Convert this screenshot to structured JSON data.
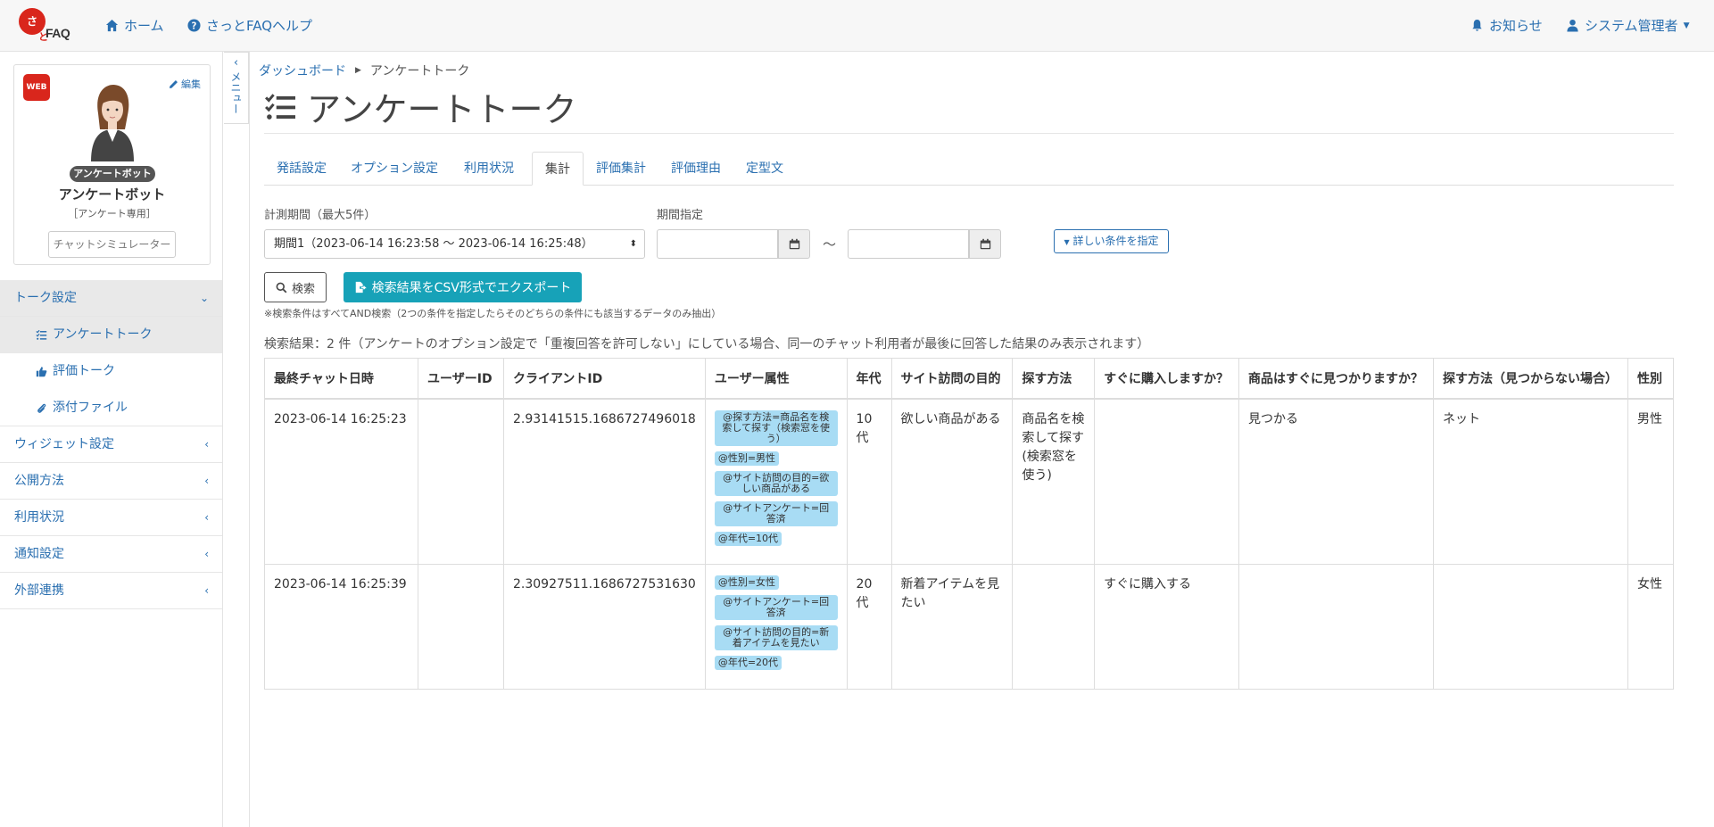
{
  "navbar": {
    "logo_text": "FAQ",
    "home": "ホーム",
    "help": "さっとFAQヘルプ",
    "notify": "お知らせ",
    "user": "システム管理者"
  },
  "bot": {
    "badge": "WEB",
    "edit": "編集",
    "tag": "アンケートボット",
    "name": "アンケートボット",
    "sub": "［アンケート専用］",
    "simulator": "チャットシミュレーター"
  },
  "menu": {
    "talk_settings": "トーク設定",
    "survey_talk": "アンケートトーク",
    "eval_talk": "評価トーク",
    "attachments": "添付ファイル",
    "widget": "ウィジェット設定",
    "publish": "公開方法",
    "usage": "利用状況",
    "notify": "通知設定",
    "external": "外部連携",
    "toggle_label": "メニュー"
  },
  "breadcrumb": {
    "dashboard": "ダッシュボード",
    "current": "アンケートトーク"
  },
  "page_title": "アンケートトーク",
  "tabs": [
    "発話設定",
    "オプション設定",
    "利用状況",
    "集計",
    "評価集計",
    "評価理由",
    "定型文"
  ],
  "filter": {
    "period_label": "計測期間（最大5件）",
    "period_value": "期間1（2023-06-14 16:23:58 〜 2023-06-14 16:25:48）",
    "range_label": "期間指定",
    "tilde": "〜",
    "detail": "詳しい条件を指定",
    "search": "検索",
    "export": "検索結果をCSV形式でエクスポート",
    "note": "※検索条件はすべてAND検索（2つの条件を指定したらそのどちらの条件にも該当するデータのみ抽出）"
  },
  "result_count": "検索結果：2 件（アンケートのオプション設定で「重複回答を許可しない」にしている場合、同一のチャット利用者が最後に回答した結果のみ表示されます）",
  "table": {
    "headers": [
      "最終チャット日時",
      "ユーザーID",
      "クライアントID",
      "ユーザー属性",
      "年代",
      "サイト訪問の目的",
      "探す方法",
      "すぐに購入しますか？",
      "商品はすぐに見つかりますか？",
      "探す方法（見つからない場合）",
      "性別"
    ],
    "rows": [
      {
        "datetime": "2023-06-14 16:25:23",
        "user_id": "",
        "client_id": "2.93141515.1686727496018",
        "tags": [
          "@探す方法=商品名を検索して探す（検索窓を使う）",
          "@性別=男性",
          "@サイト訪問の目的=欲しい商品がある",
          "@サイトアンケート=回答済",
          "@年代=10代"
        ],
        "age": "10代",
        "purpose": "欲しい商品がある",
        "method": "商品名を検索して探す(検索窓を使う)",
        "buy_now": "",
        "find": "見つかる",
        "method_nf": "ネット",
        "gender": "男性"
      },
      {
        "datetime": "2023-06-14 16:25:39",
        "user_id": "",
        "client_id": "2.30927511.1686727531630",
        "tags": [
          "@性別=女性",
          "@サイトアンケート=回答済",
          "@サイト訪問の目的=新着アイテムを見たい",
          "@年代=20代"
        ],
        "age": "20代",
        "purpose": "新着アイテムを見たい",
        "method": "",
        "buy_now": "すぐに購入する",
        "find": "",
        "method_nf": "",
        "gender": "女性"
      }
    ]
  },
  "colors": {
    "link": "#2a6fb0",
    "brand": "#d9261c",
    "export": "#17a2b8",
    "tag_bg": "#a8dcf4"
  }
}
